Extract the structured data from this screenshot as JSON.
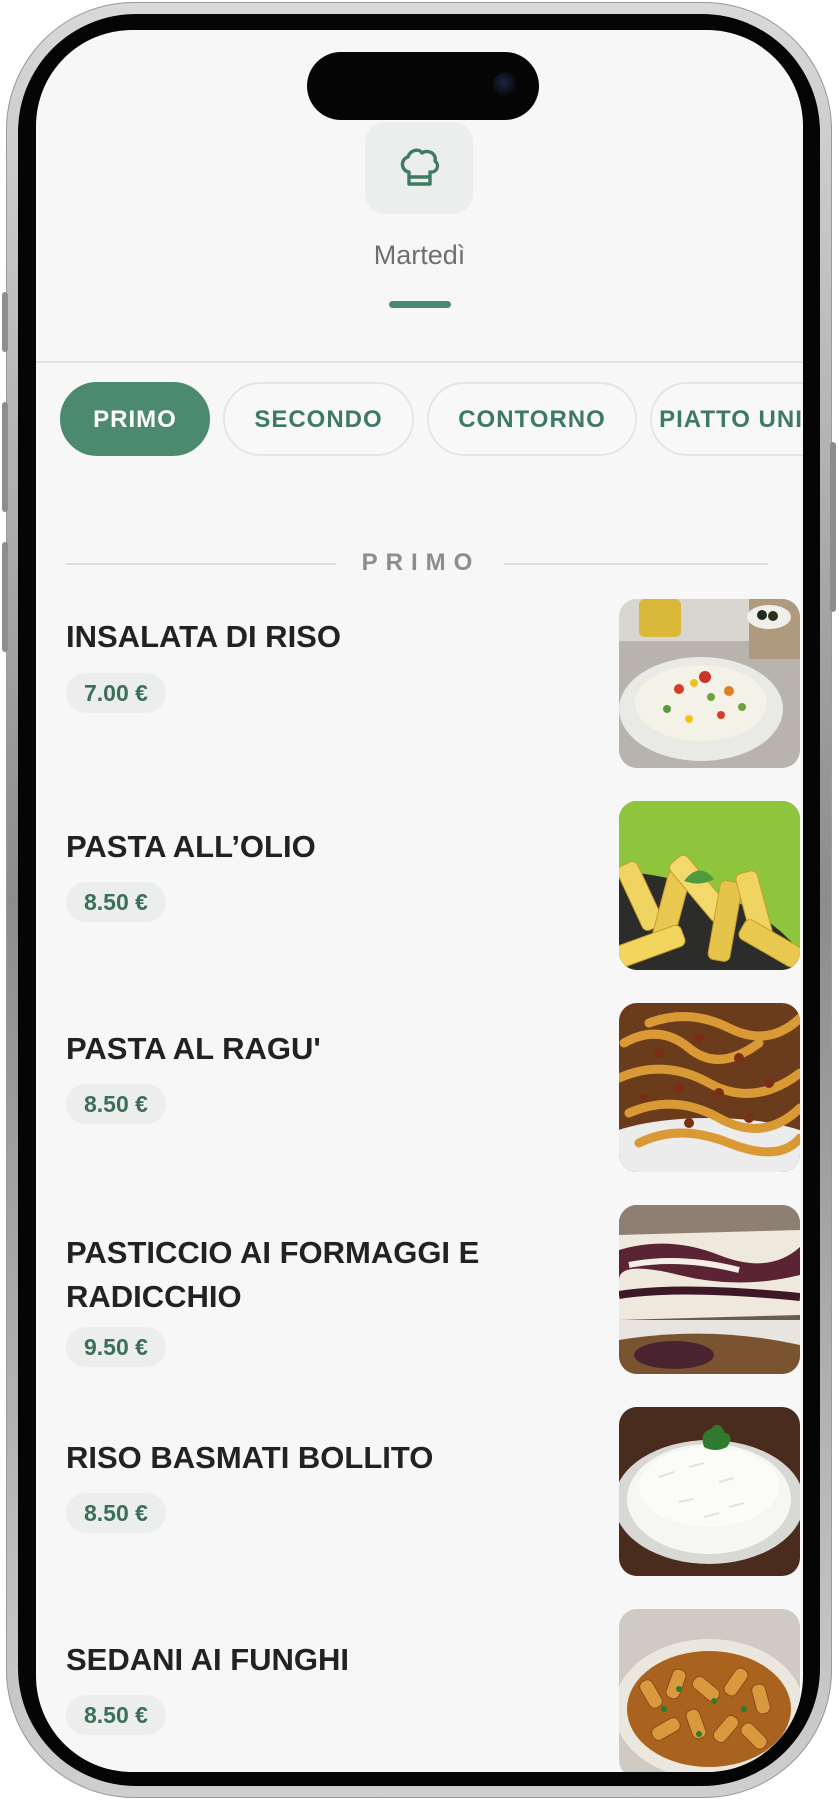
{
  "header": {
    "icon": "chef-hat-icon",
    "day_label": "Martedì"
  },
  "tabs": [
    {
      "label": "PRIMO",
      "active": true
    },
    {
      "label": "SECONDO",
      "active": false
    },
    {
      "label": "CONTORNO",
      "active": false
    },
    {
      "label": "PIATTO UNICO",
      "active": false
    }
  ],
  "section": {
    "title": "PRIMO"
  },
  "items": [
    {
      "name": "INSALATA DI RISO",
      "price": "7.00 €",
      "image": "insalata-di-riso-photo"
    },
    {
      "name": "PASTA ALL’OLIO",
      "price": "8.50 €",
      "image": "pasta-all-olio-photo"
    },
    {
      "name": "PASTA AL RAGU'",
      "price": "8.50 €",
      "image": "pasta-al-ragu-photo"
    },
    {
      "name": "PASTICCIO AI FORMAGGI E RADICCHIO",
      "price": "9.50 €",
      "image": "pasticcio-photo"
    },
    {
      "name": "RISO BASMATI BOLLITO",
      "price": "8.50 €",
      "image": "riso-basmati-photo"
    },
    {
      "name": "SEDANI AI FUNGHI",
      "price": "8.50 €",
      "image": "sedani-ai-funghi-photo"
    }
  ],
  "colors": {
    "accent": "#4b8a6f",
    "price_text": "#3c6e58",
    "price_bg": "#ebeeec",
    "background": "#f7f7f7"
  }
}
